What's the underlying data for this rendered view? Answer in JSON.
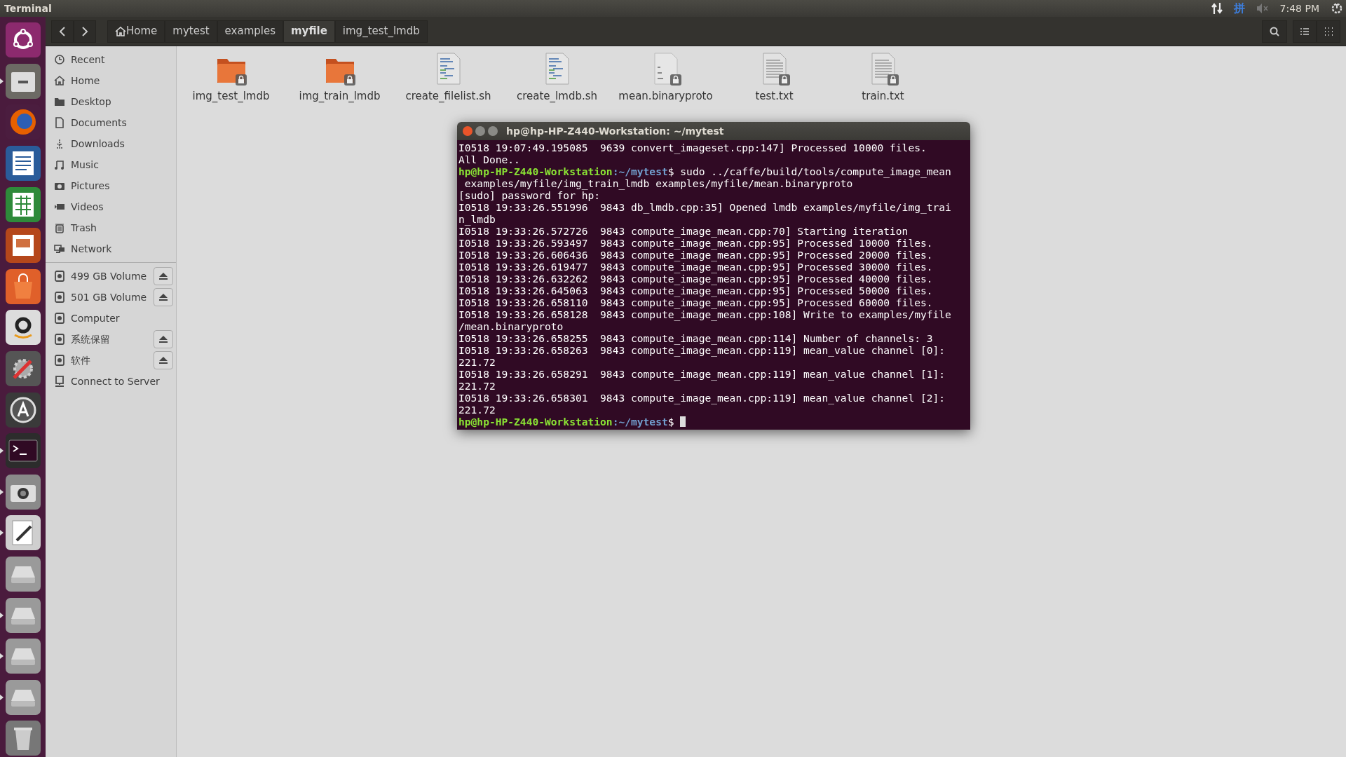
{
  "top_bar": {
    "app_title": "Terminal",
    "input_method": "拼",
    "clock": "7:48 PM",
    "muted": true
  },
  "launcher": [
    {
      "kind": "ubuntu",
      "running": false
    },
    {
      "kind": "files",
      "running": true
    },
    {
      "kind": "browser",
      "running": false
    },
    {
      "kind": "writer",
      "running": false
    },
    {
      "kind": "calc",
      "running": false
    },
    {
      "kind": "impress",
      "running": false
    },
    {
      "kind": "store",
      "running": false
    },
    {
      "kind": "amazon",
      "running": false
    },
    {
      "kind": "settings",
      "running": false
    },
    {
      "kind": "updater",
      "running": false
    },
    {
      "kind": "terminal",
      "running": true
    },
    {
      "kind": "camera",
      "running": true
    },
    {
      "kind": "editor",
      "running": true
    },
    {
      "kind": "drive",
      "running": false
    },
    {
      "kind": "drive",
      "running": true
    },
    {
      "kind": "drive",
      "running": true
    },
    {
      "kind": "drive",
      "running": true
    },
    {
      "kind": "trash",
      "running": false
    }
  ],
  "breadcrumbs": [
    {
      "label": "Home",
      "kind": "home",
      "selected": false
    },
    {
      "label": "mytest",
      "kind": "folder",
      "selected": false
    },
    {
      "label": "examples",
      "kind": "folder",
      "selected": false
    },
    {
      "label": "myfile",
      "kind": "folder",
      "selected": true
    },
    {
      "label": "img_test_lmdb",
      "kind": "folder",
      "selected": false
    }
  ],
  "sidebar": {
    "places": [
      {
        "label": "Recent",
        "kind": "recent"
      },
      {
        "label": "Home",
        "kind": "home"
      },
      {
        "label": "Desktop",
        "kind": "desktop"
      },
      {
        "label": "Documents",
        "kind": "documents"
      },
      {
        "label": "Downloads",
        "kind": "downloads"
      },
      {
        "label": "Music",
        "kind": "music"
      },
      {
        "label": "Pictures",
        "kind": "pictures"
      },
      {
        "label": "Videos",
        "kind": "videos"
      },
      {
        "label": "Trash",
        "kind": "trash"
      },
      {
        "label": "Network",
        "kind": "network"
      }
    ],
    "devices": [
      {
        "label": "499 GB Volume",
        "kind": "drive",
        "ejectable": true
      },
      {
        "label": "501 GB Volume",
        "kind": "drive",
        "ejectable": true
      },
      {
        "label": "Computer",
        "kind": "drive",
        "ejectable": false
      },
      {
        "label": "系统保留",
        "kind": "drive",
        "ejectable": true
      },
      {
        "label": "软件",
        "kind": "drive",
        "ejectable": true
      },
      {
        "label": "Connect to Server",
        "kind": "server",
        "ejectable": false
      }
    ]
  },
  "files": [
    {
      "name": "img_test_lmdb",
      "kind": "folder",
      "locked": true
    },
    {
      "name": "img_train_lmdb",
      "kind": "folder",
      "locked": true
    },
    {
      "name": "create_filelist.sh",
      "kind": "script",
      "locked": false
    },
    {
      "name": "create_lmdb.sh",
      "kind": "script",
      "locked": false
    },
    {
      "name": "mean.binaryproto",
      "kind": "binary",
      "locked": true
    },
    {
      "name": "test.txt",
      "kind": "text",
      "locked": true
    },
    {
      "name": "train.txt",
      "kind": "text",
      "locked": true
    }
  ],
  "terminal": {
    "title": "hp@hp-HP-Z440-Workstation: ~/mytest",
    "lines": [
      {
        "kind": "output",
        "text": "I0518 19:07:49.195085  9639 convert_imageset.cpp:147] Processed 10000 files."
      },
      {
        "kind": "output",
        "text": "All Done.."
      },
      {
        "kind": "prompt",
        "user": "hp@hp-HP-Z440-Workstation",
        "path": ":~/mytest",
        "command": "$ sudo ../caffe/build/tools/compute_image_mean"
      },
      {
        "kind": "output",
        "text": " examples/myfile/img_train_lmdb examples/myfile/mean.binaryproto"
      },
      {
        "kind": "output",
        "text": "[sudo] password for hp:"
      },
      {
        "kind": "output",
        "text": "I0518 19:33:26.551996  9843 db_lmdb.cpp:35] Opened lmdb examples/myfile/img_trai"
      },
      {
        "kind": "output",
        "text": "n_lmdb"
      },
      {
        "kind": "output",
        "text": "I0518 19:33:26.572726  9843 compute_image_mean.cpp:70] Starting iteration"
      },
      {
        "kind": "output",
        "text": "I0518 19:33:26.593497  9843 compute_image_mean.cpp:95] Processed 10000 files."
      },
      {
        "kind": "output",
        "text": "I0518 19:33:26.606436  9843 compute_image_mean.cpp:95] Processed 20000 files."
      },
      {
        "kind": "output",
        "text": "I0518 19:33:26.619477  9843 compute_image_mean.cpp:95] Processed 30000 files."
      },
      {
        "kind": "output",
        "text": "I0518 19:33:26.632262  9843 compute_image_mean.cpp:95] Processed 40000 files."
      },
      {
        "kind": "output",
        "text": "I0518 19:33:26.645063  9843 compute_image_mean.cpp:95] Processed 50000 files."
      },
      {
        "kind": "output",
        "text": "I0518 19:33:26.658110  9843 compute_image_mean.cpp:95] Processed 60000 files."
      },
      {
        "kind": "output",
        "text": "I0518 19:33:26.658128  9843 compute_image_mean.cpp:108] Write to examples/myfile"
      },
      {
        "kind": "output",
        "text": "/mean.binaryproto"
      },
      {
        "kind": "output",
        "text": "I0518 19:33:26.658255  9843 compute_image_mean.cpp:114] Number of channels: 3"
      },
      {
        "kind": "output",
        "text": "I0518 19:33:26.658263  9843 compute_image_mean.cpp:119] mean_value channel [0]:"
      },
      {
        "kind": "output",
        "text": "221.72"
      },
      {
        "kind": "output",
        "text": "I0518 19:33:26.658291  9843 compute_image_mean.cpp:119] mean_value channel [1]:"
      },
      {
        "kind": "output",
        "text": "221.72"
      },
      {
        "kind": "output",
        "text": "I0518 19:33:26.658301  9843 compute_image_mean.cpp:119] mean_value channel [2]:"
      },
      {
        "kind": "output",
        "text": "221.72"
      },
      {
        "kind": "prompt",
        "user": "hp@hp-HP-Z440-Workstation",
        "path": ":~/mytest",
        "command": "$ ",
        "cursor": true
      }
    ]
  }
}
